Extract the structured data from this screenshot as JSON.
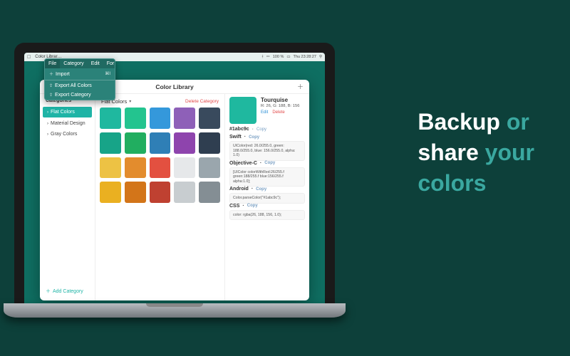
{
  "promo": {
    "line1_a": "Backup",
    "line1_b": " or",
    "line2_a": "share",
    "line2_b": " your",
    "line3": "colors"
  },
  "menubar": {
    "app_title": "Color Librar…",
    "right_status": [
      "100 %",
      "Thu 23:28:27"
    ]
  },
  "dropdown": {
    "tabs": [
      "File",
      "Category",
      "Edit",
      "For"
    ],
    "import": "Import",
    "import_shortcut": "⌘I",
    "export_all": "Export All Colors",
    "export_category": "Export Category"
  },
  "window": {
    "title": "Color Library"
  },
  "sidebar": {
    "heading": "Categories",
    "items": [
      {
        "label": "Flat Colors"
      },
      {
        "label": "Material Design"
      },
      {
        "label": "Gray Colors"
      }
    ],
    "add": "Add Category"
  },
  "center": {
    "category_name": "Flat Colors",
    "delete": "Delete Category",
    "swatches": [
      "#1fb89f",
      "#23c48f",
      "#3498db",
      "#8e60b8",
      "#394a5d",
      "#17a488",
      "#21ae60",
      "#2f7fb6",
      "#8e44ad",
      "#2f3e50",
      "#edc244",
      "#e38c2d",
      "#e35040",
      "#e6e8ea",
      "#9aa6ad",
      "#eab021",
      "#d37519",
      "#bf4131",
      "#c8cdd0",
      "#848e94"
    ]
  },
  "detail": {
    "swatch_color": "#1fb89f",
    "name": "Tourquise",
    "rgb": "R: 26, G: 188, B: 156",
    "edit": "Edit",
    "delete": "Delete",
    "hex": "#1abc9c",
    "copy": "Copy",
    "blocks": [
      {
        "lang": "Swift",
        "code": "UIColor(red: 26.0/255.0, green: 188.0/255.0, blue: 156.0/255.0, alpha: 1.0)"
      },
      {
        "lang": "Objective-C",
        "code": "[UIColor colorWithRed:26/255.f green:188/255.f blue:156/255.f alpha:1.0];"
      },
      {
        "lang": "Android",
        "code": "Color.parseColor(\"#1abc9c\");"
      },
      {
        "lang": "CSS",
        "code": "color: rgba(26, 188, 156, 1.0);"
      }
    ]
  }
}
